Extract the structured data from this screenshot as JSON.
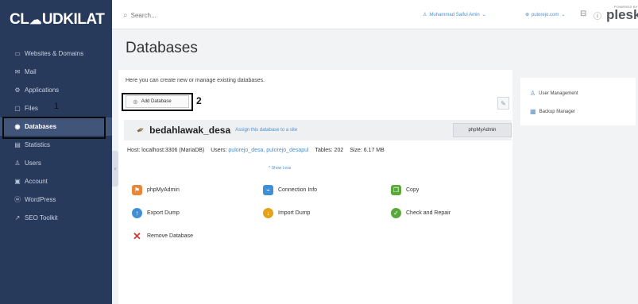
{
  "brand": {
    "logo_text_left": "CL",
    "logo_text_right": "UDKILAT"
  },
  "sidebar": {
    "items": [
      {
        "label": "Websites & Domains",
        "icon": "monitor-icon"
      },
      {
        "label": "Mail",
        "icon": "mail-icon"
      },
      {
        "label": "Applications",
        "icon": "gear-icon"
      },
      {
        "label": "Files",
        "icon": "folder-icon"
      },
      {
        "label": "Databases",
        "icon": "database-icon",
        "active": true
      },
      {
        "label": "Statistics",
        "icon": "chart-icon"
      },
      {
        "label": "Users",
        "icon": "user-icon"
      },
      {
        "label": "Account",
        "icon": "account-icon"
      },
      {
        "label": "WordPress",
        "icon": "wordpress-icon"
      },
      {
        "label": "SEO Toolkit",
        "icon": "seo-icon"
      }
    ],
    "step_marker": "1"
  },
  "topbar": {
    "search_placeholder": "Search...",
    "user_label": "Muhammad Saiful Amin",
    "domain_label": "pulorejo.com",
    "plesk_powered": "POWERED BY",
    "plesk_word": "plesk"
  },
  "main": {
    "title": "Databases",
    "description": "Here you can create new or manage existing databases.",
    "add_button": "Add Database",
    "step_marker": "2",
    "database": {
      "name": "bedahlawak_desa",
      "assign_link": "Assign this database to a site",
      "phpmyadmin_button": "phpMyAdmin",
      "host_label": "Host: localhost:3306 (MariaDB)",
      "users_label": "Users:",
      "users": "pulorejo_desa, pulorejo_desapul",
      "tables_label": "Tables: 202",
      "size_label": "Size: 6.17 MB",
      "show_less": "^ Show Less"
    },
    "actions": [
      {
        "label": "phpMyAdmin",
        "icon": "phpmyadmin-icon",
        "color": "#e8863a"
      },
      {
        "label": "Connection Info",
        "icon": "connection-icon",
        "color": "#3f8fd6"
      },
      {
        "label": "Copy",
        "icon": "copy-icon",
        "color": "#5aa83c"
      },
      {
        "label": "Export Dump",
        "icon": "export-icon",
        "color": "#3f8fd6"
      },
      {
        "label": "Import Dump",
        "icon": "import-icon",
        "color": "#e3a21a"
      },
      {
        "label": "Check and Repair",
        "icon": "check-icon",
        "color": "#5aa83c"
      },
      {
        "label": "Remove Database",
        "icon": "remove-icon",
        "color": "#d43b2f"
      }
    ]
  },
  "side_panel": {
    "links": [
      {
        "label": "User Management",
        "icon": "user-management-icon"
      },
      {
        "label": "Backup Manager",
        "icon": "backup-icon"
      }
    ]
  },
  "colors": {
    "sidebar_bg": "#283a5c",
    "link": "#4a8fd0",
    "active_item": "#41557a"
  }
}
